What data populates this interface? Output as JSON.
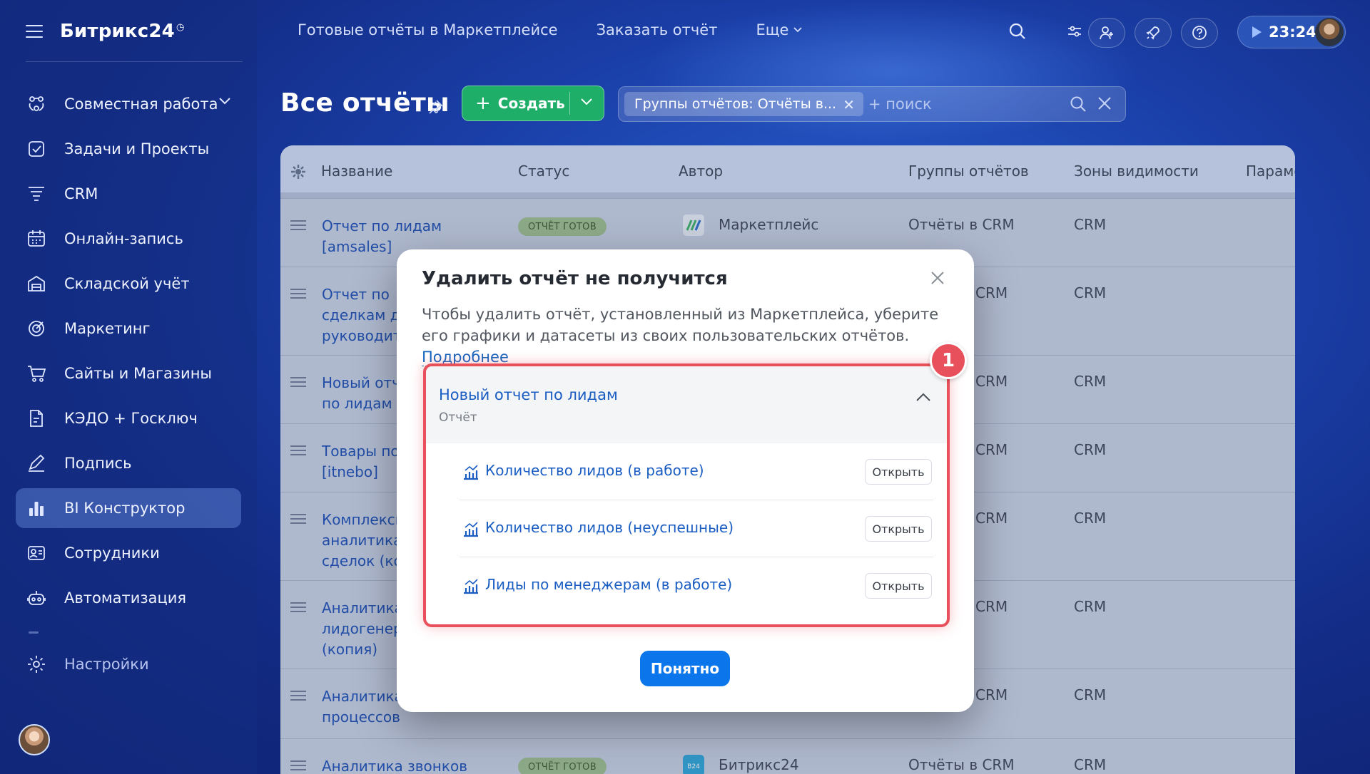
{
  "app": {
    "brand": "Битрикс24",
    "brand_mark": "◷"
  },
  "sidebar": {
    "items": [
      {
        "label": "Совместная работа",
        "icon": "collab-icon"
      },
      {
        "label": "Задачи и Проекты",
        "icon": "tasks-icon"
      },
      {
        "label": "CRM",
        "icon": "crm-icon"
      },
      {
        "label": "Онлайн-запись",
        "icon": "calendar-icon"
      },
      {
        "label": "Складской учёт",
        "icon": "warehouse-icon"
      },
      {
        "label": "Маркетинг",
        "icon": "marketing-icon"
      },
      {
        "label": "Сайты и Магазины",
        "icon": "cart-icon"
      },
      {
        "label": "КЭДО + Госключ",
        "icon": "document-icon"
      },
      {
        "label": "Подпись",
        "icon": "signature-icon"
      },
      {
        "label": "BI Конструктор",
        "icon": "bar-chart-icon"
      },
      {
        "label": "Сотрудники",
        "icon": "employees-icon"
      },
      {
        "label": "Автоматизация",
        "icon": "robot-icon"
      }
    ],
    "settings": "Настройки"
  },
  "topnav": {
    "items": [
      "Готовые отчёты в Маркетплейсе",
      "Заказать отчёт"
    ],
    "more": "Еще"
  },
  "clock": "23:24",
  "page": {
    "title": "Все отчёты",
    "create": "Создать"
  },
  "search": {
    "chip": "Группы отчётов: Отчёты в...",
    "placeholder": "+ поиск"
  },
  "table": {
    "headers": [
      "Название",
      "Статус",
      "Автор",
      "Группы отчётов",
      "Зоны видимости",
      "Параме"
    ],
    "rows": [
      {
        "name": [
          "Отчет по лидам",
          "[amsales]"
        ],
        "status": "ОТЧЁТ ГОТОВ",
        "author": "Маркетплейс",
        "group": "Отчёты в CRM",
        "zone": "CRM"
      },
      {
        "name": [
          "Отчет по",
          "сделкам д",
          "руководит"
        ],
        "status": "",
        "author": "",
        "group": "CRM",
        "zone": "CRM"
      },
      {
        "name": [
          "Новый отч",
          "по лидам"
        ],
        "status": "",
        "author": "",
        "group": "CRM",
        "zone": "CRM"
      },
      {
        "name": [
          "Товары по",
          "[itnebo]"
        ],
        "status": "",
        "author": "",
        "group": "CRM",
        "zone": "CRM"
      },
      {
        "name": [
          "Комплексн",
          "аналитика",
          "сделок (ко"
        ],
        "status": "",
        "author": "",
        "group": "CRM",
        "zone": "CRM"
      },
      {
        "name": [
          "Аналитика",
          "лидогенер",
          "(копия)"
        ],
        "status": "",
        "author": "",
        "group": "CRM",
        "zone": "CRM"
      },
      {
        "name": [
          "Аналитика",
          "процессов"
        ],
        "status": "",
        "author": "",
        "group": "CRM",
        "zone": "CRM"
      },
      {
        "name": [
          "Аналитика звонков"
        ],
        "status": "ОТЧЁТ ГОТОВ",
        "author": "Битрикс24",
        "group": "Отчёты в CRM",
        "zone": "CRM"
      }
    ]
  },
  "modal": {
    "title": "Удалить отчёт не получится",
    "text": "Чтобы удалить отчёт, установленный из Маркетплейса, уберите его графики и датасеты из своих пользовательских отчётов.",
    "link": "Подробнее",
    "badge": "1",
    "group_title": "Новый отчет по лидам",
    "group_sub": "Отчёт",
    "items": [
      {
        "label": "Количество лидов (в работе)",
        "button": "Открыть"
      },
      {
        "label": "Количество лидов (неуспешные)",
        "button": "Открыть"
      },
      {
        "label": "Лиды по менеджерам (в работе)",
        "button": "Открыть"
      }
    ],
    "ok": "Понятно"
  },
  "colors": {
    "accent": "#0b75ec",
    "create": "#1eae68",
    "highlight": "#e8505b",
    "link": "#1a5dc2"
  }
}
